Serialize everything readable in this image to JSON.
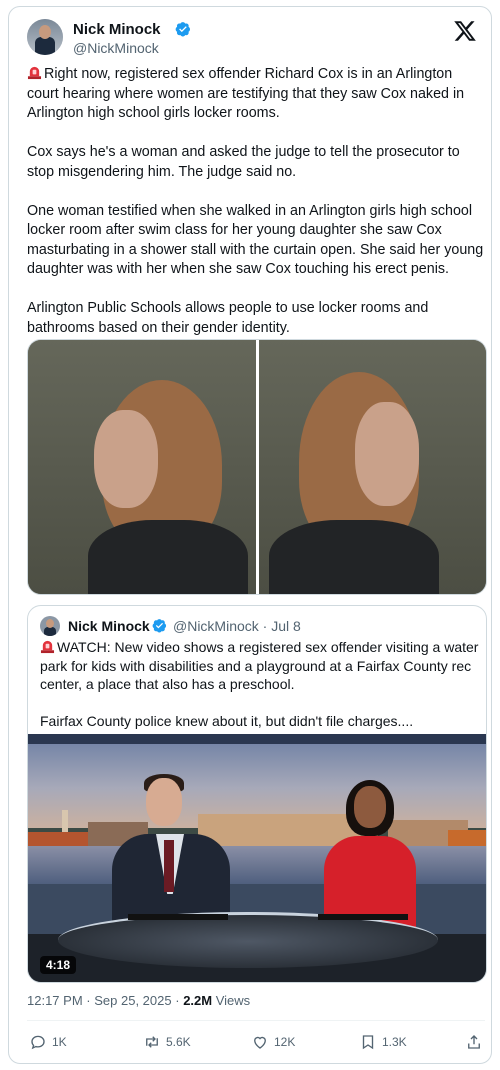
{
  "author": {
    "name": "Nick Minock",
    "handle": "@NickMinock"
  },
  "tweet": {
    "paragraphs": [
      "Right now, registered sex offender Richard Cox is in an Arlington court hearing where women are testifying that they saw Cox naked in Arlington high school girls locker rooms.",
      "Cox says he's a woman and asked the judge to tell the prosecutor to stop misgendering him. The judge said no.",
      "One woman testified when she walked in an Arlington girls high school locker room after swim class for her young daughter she saw Cox masturbating in a shower stall with the curtain open.  She said her young daughter was with her when she saw Cox touching his erect penis.",
      "Arlington Public Schools allows people to use locker rooms and bathrooms based on their gender identity."
    ],
    "siren_icon": "police-siren-emoji"
  },
  "quoted": {
    "name": "Nick Minock",
    "handle": "@NickMinock",
    "date": "Jul 8",
    "paragraphs": [
      "WATCH: New video shows a registered sex offender visiting a water park for kids with disabilities and a playground at a Fairfax County rec center, a place that also has a preschool.",
      "Fairfax County police knew about it, but didn't file charges...."
    ],
    "video_duration": "4:18"
  },
  "meta": {
    "time": "12:17 PM",
    "separator": "·",
    "date": "Sep 25, 2025",
    "views_count": "2.2M",
    "views_label": "Views"
  },
  "actions": {
    "replies": "1K",
    "reposts": "5.6K",
    "likes": "12K",
    "bookmarks": "1.3K"
  },
  "colors": {
    "verified": "#1d9bf0",
    "secondary_text": "#536471",
    "border": "#cfd9de"
  }
}
